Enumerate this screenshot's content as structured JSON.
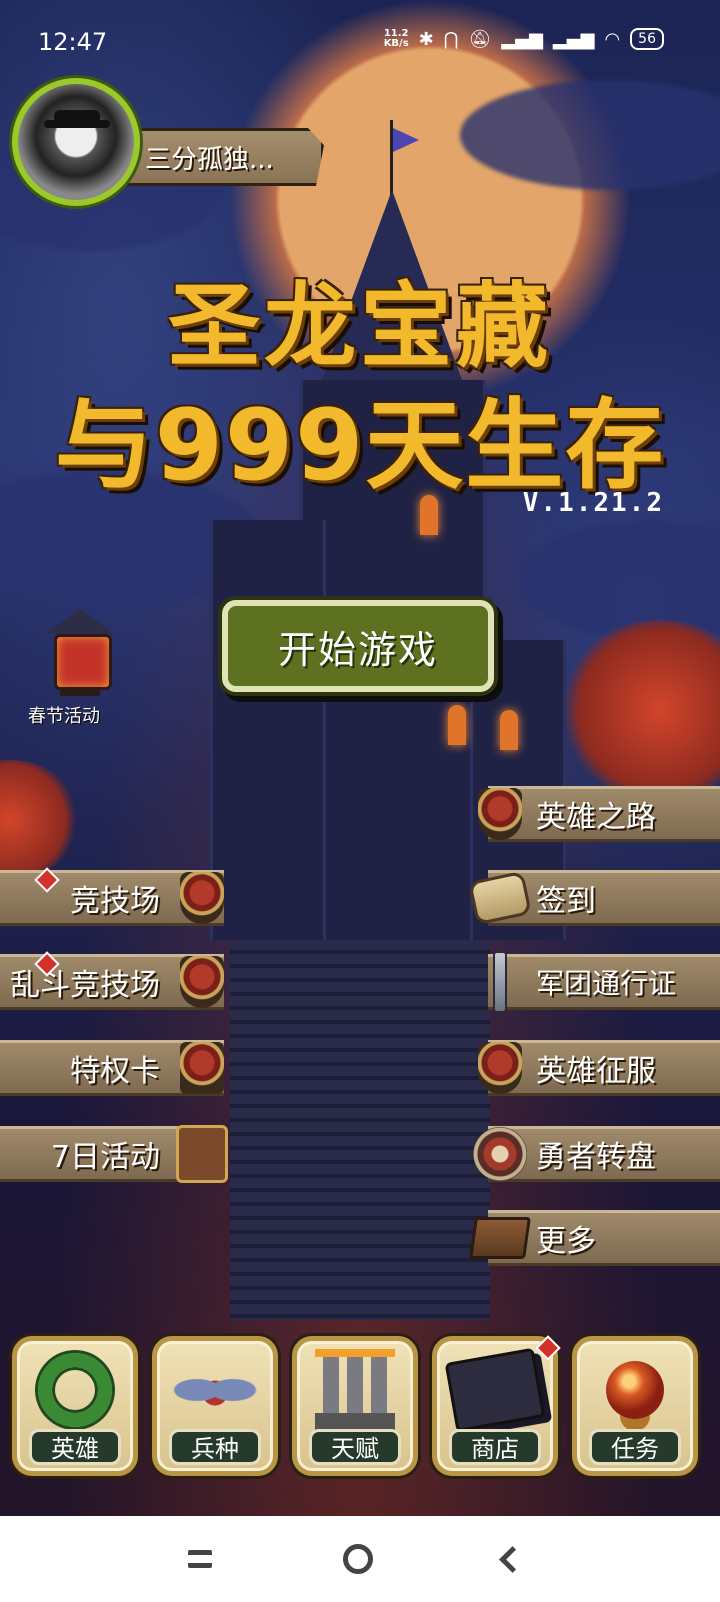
{
  "status_bar": {
    "time": "12:47",
    "net_speed_value": "11.2",
    "net_speed_unit": "KB/s",
    "battery": "56"
  },
  "profile": {
    "name": "三分孤独..."
  },
  "title": {
    "line1": "圣龙宝藏",
    "line2": "与999天生存",
    "version": "V.1.21.2"
  },
  "start_button": "开始游戏",
  "event": {
    "label": "春节活动"
  },
  "left_menu": [
    {
      "label": "竞技场",
      "icon": "arena-crest-icon",
      "badge": true
    },
    {
      "label": "乱斗竞技场",
      "icon": "brawl-crest-icon",
      "badge": true
    },
    {
      "label": "特权卡",
      "icon": "privilege-card-icon",
      "badge": false
    },
    {
      "label": "7日活动",
      "icon": "seven-day-book-icon",
      "badge": false
    }
  ],
  "right_menu": [
    {
      "label": "英雄之路",
      "icon": "hero-path-crest-icon"
    },
    {
      "label": "签到",
      "icon": "scroll-icon"
    },
    {
      "label": "军团通行证",
      "icon": "sword-emblem-icon"
    },
    {
      "label": "英雄征服",
      "icon": "shield-icon"
    },
    {
      "label": "勇者转盘",
      "icon": "wheel-icon"
    },
    {
      "label": "更多",
      "icon": "book-icon"
    }
  ],
  "bottom_tabs": [
    {
      "label": "英雄",
      "icon": "wreath-icon",
      "badge": false
    },
    {
      "label": "兵种",
      "icon": "wings-icon",
      "badge": false
    },
    {
      "label": "天赋",
      "icon": "altar-icon",
      "badge": false
    },
    {
      "label": "商店",
      "icon": "cards-icon",
      "badge": true
    },
    {
      "label": "任务",
      "icon": "orb-icon",
      "badge": false
    }
  ],
  "colors": {
    "title_gold": "#f1b92b",
    "start_green": "#5d7120",
    "avatar_ring": "#9bc92a",
    "badge_red": "#d3322a"
  }
}
